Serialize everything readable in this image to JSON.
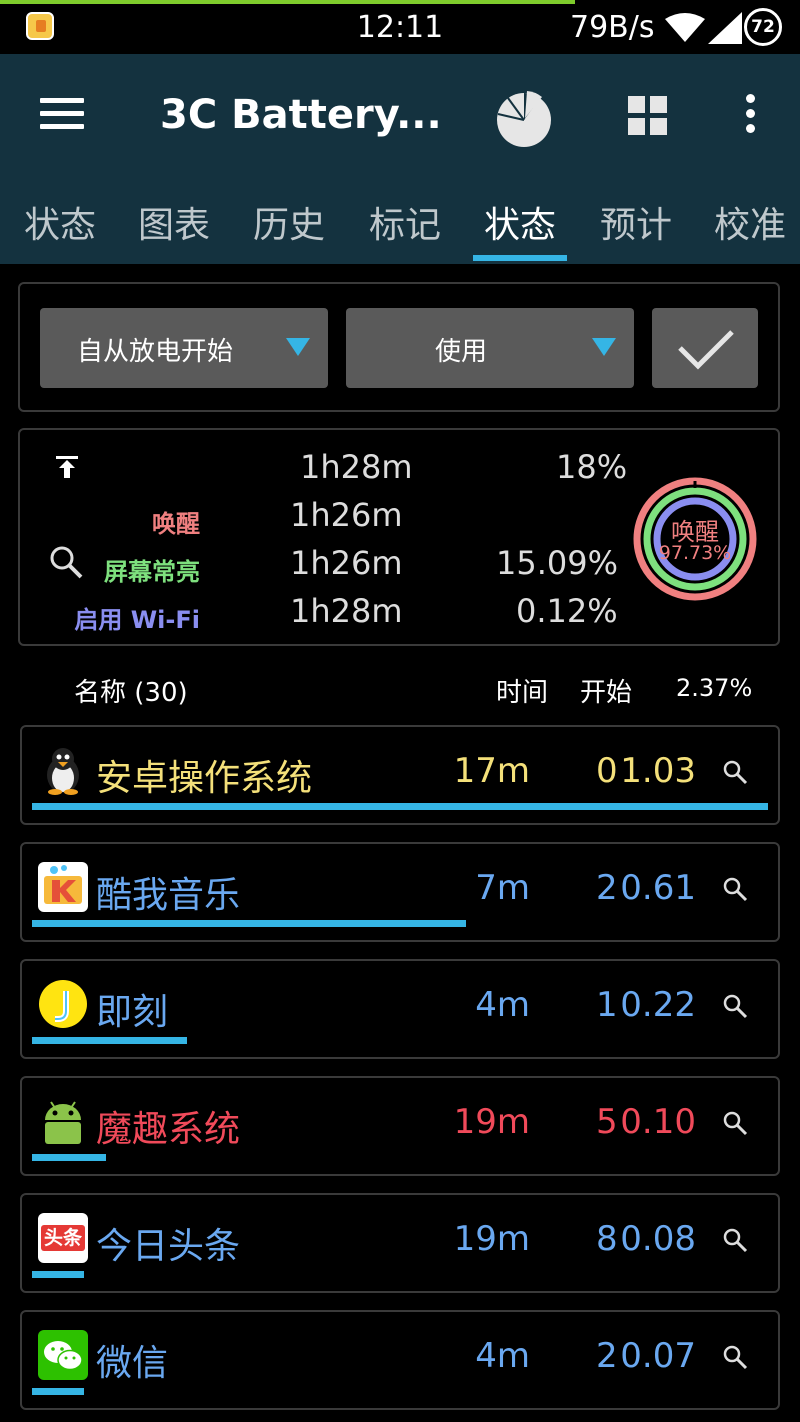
{
  "status_bar": {
    "time": "12:11",
    "net_speed": "79B/s",
    "battery_level": "72"
  },
  "toolbar": {
    "title": "3C Battery..."
  },
  "tabs": [
    {
      "label": "状态",
      "active": false
    },
    {
      "label": "图表",
      "active": false
    },
    {
      "label": "历史",
      "active": false
    },
    {
      "label": "标记",
      "active": false
    },
    {
      "label": "状态",
      "active": true
    },
    {
      "label": "预计",
      "active": false
    },
    {
      "label": "校准",
      "active": false
    }
  ],
  "filters": {
    "period": "自从放电开始",
    "mode": "使用"
  },
  "summary": {
    "total_time": "1h28m",
    "total_pct": "18%",
    "rows": [
      {
        "label": "唤醒",
        "time": "1h26m",
        "pct": "",
        "color": "#f08080"
      },
      {
        "label": "屏幕常亮",
        "time": "1h26m",
        "pct": "15.09%",
        "color": "#7ee07e"
      },
      {
        "label": "启用 Wi-Fi",
        "time": "1h28m",
        "pct": "0.12%",
        "color": "#8a8ef0"
      }
    ],
    "ring_label": "唤醒",
    "ring_value": "97.73%"
  },
  "list_header": {
    "name": "名称 (30)",
    "time": "时间",
    "start": "开始",
    "pct": "2.37%"
  },
  "apps": [
    {
      "name": "安卓操作系统",
      "time": "17m",
      "count": "0",
      "pct": "1.03",
      "color": "#f4e07a",
      "icon": "penguin-icon",
      "bar": 1.0
    },
    {
      "name": "酷我音乐",
      "time": "7m",
      "count": "2",
      "pct": "0.61",
      "color": "#6aa8f0",
      "icon": "kuwo-music-icon",
      "bar": 0.59
    },
    {
      "name": "即刻",
      "time": "4m",
      "count": "1",
      "pct": "0.22",
      "color": "#6aa8f0",
      "icon": "jike-icon",
      "bar": 0.21
    },
    {
      "name": "魔趣系统",
      "time": "19m",
      "count": "5",
      "pct": "0.10",
      "color": "#f04a5a",
      "icon": "android-icon",
      "bar": 0.1
    },
    {
      "name": "今日头条",
      "time": "19m",
      "count": "8",
      "pct": "0.08",
      "color": "#6aa8f0",
      "icon": "toutiao-icon",
      "bar": 0.07
    },
    {
      "name": "微信",
      "time": "4m",
      "count": "2",
      "pct": "0.07",
      "color": "#6aa8f0",
      "icon": "wechat-icon",
      "bar": 0.07
    }
  ],
  "colors": {
    "accent": "#35b5e5",
    "toolbar": "#14323f"
  }
}
